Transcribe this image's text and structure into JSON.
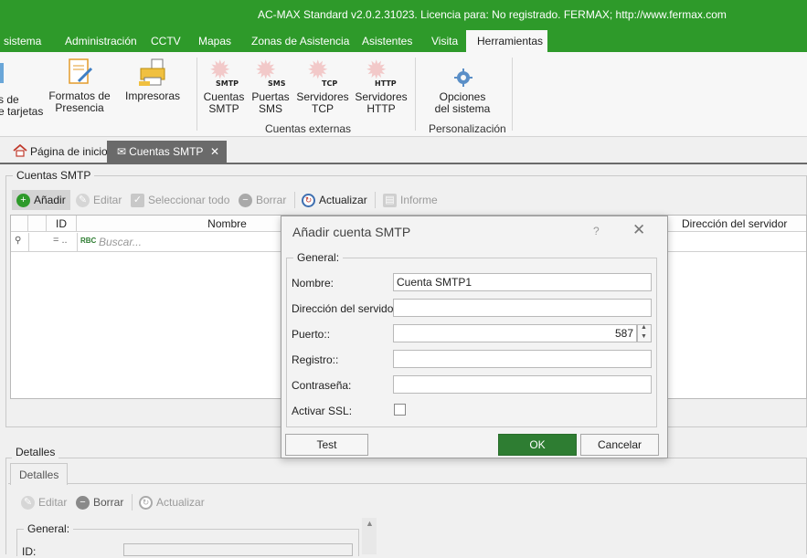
{
  "window": {
    "title": "AC-MAX Standard v2.0.2.31023. Licencia para: No registrado. FERMAX; http://www.fermax.com"
  },
  "menu": [
    {
      "label": "l sistema"
    },
    {
      "label": "Administración"
    },
    {
      "label": "CCTV"
    },
    {
      "label": "Mapas"
    },
    {
      "label": "Zonas de Asistencia"
    },
    {
      "label": "Asistentes"
    },
    {
      "label": "Visita"
    },
    {
      "label": "Herramientas"
    }
  ],
  "ribbon": {
    "buttons": [
      {
        "line1": "s de",
        "line2": "e tarjetas"
      },
      {
        "line1": "Formatos de",
        "line2": "Presencia"
      },
      {
        "line1": "Impresoras",
        "line2": ""
      },
      {
        "proto": "SMTP",
        "line1": "Cuentas",
        "line2": "SMTP"
      },
      {
        "proto": "SMS",
        "line1": "Puertas",
        "line2": "SMS"
      },
      {
        "proto": "TCP",
        "line1": "Servidores",
        "line2": "TCP"
      },
      {
        "proto": "HTTP",
        "line1": "Servidores",
        "line2": "HTTP"
      },
      {
        "line1": "Opciones",
        "line2": "del sistema"
      }
    ],
    "groups": {
      "external": "Cuentas externas",
      "personalization": "Personalización"
    }
  },
  "tabs": [
    {
      "label": "Página de inicio"
    },
    {
      "label": "Cuentas SMTP"
    }
  ],
  "smtp_panel": {
    "title": "Cuentas SMTP",
    "toolbar": {
      "add": "Añadir",
      "edit": "Editar",
      "select_all": "Seleccionar todo",
      "delete": "Borrar",
      "refresh": "Actualizar",
      "report": "Informe"
    },
    "grid": {
      "columns": {
        "id": "ID",
        "name": "Nombre",
        "server": "Dirección del servidor"
      },
      "search_placeholder": "Buscar..."
    }
  },
  "dialog": {
    "title": "Añadir cuenta SMTP",
    "help": "?",
    "group": "General:",
    "fields": {
      "name_label": "Nombre:",
      "name_value": "Cuenta SMTP1",
      "server_label": "Dirección del servidor:",
      "server_value": "",
      "port_label": "Puerto::",
      "port_value": "587",
      "registry_label": "Registro::",
      "registry_value": "",
      "password_label": "Contraseña:",
      "password_value": "",
      "ssl_label": "Activar SSL:"
    },
    "buttons": {
      "test": "Test",
      "ok": "OK",
      "cancel": "Cancelar"
    }
  },
  "details": {
    "title": "Detalles",
    "tab": "Detalles",
    "toolbar": {
      "edit": "Editar",
      "delete": "Borrar",
      "refresh": "Actualizar"
    },
    "group": "General:",
    "id_label": "ID:"
  },
  "colors": {
    "accent": "#2e9a2a",
    "ok_button": "#2e7d32"
  }
}
